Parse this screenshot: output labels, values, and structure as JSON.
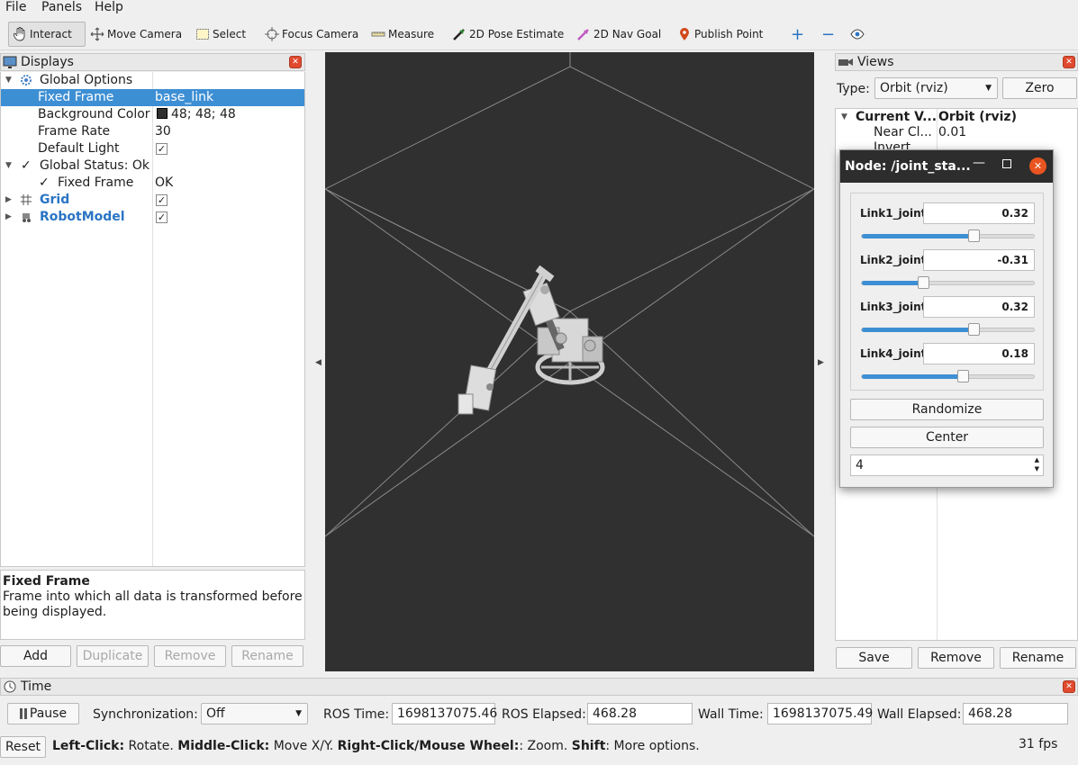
{
  "menu": {
    "file": "File",
    "panels": "Panels",
    "help": "Help"
  },
  "toolbar": {
    "interact": "Interact",
    "move_camera": "Move Camera",
    "select": "Select",
    "focus_camera": "Focus Camera",
    "measure": "Measure",
    "pose_estimate": "2D Pose Estimate",
    "nav_goal": "2D Nav Goal",
    "publish_point": "Publish Point",
    "plus": "+",
    "minus": "−"
  },
  "displays": {
    "title": "Displays",
    "rows": [
      {
        "key": "Global Options",
        "value": ""
      },
      {
        "key": "Fixed Frame",
        "value": "base_link"
      },
      {
        "key": "Background Color",
        "value": "48; 48; 48"
      },
      {
        "key": "Frame Rate",
        "value": "30"
      },
      {
        "key": "Default Light",
        "value": "✓"
      },
      {
        "key": "Global Status: Ok",
        "value": ""
      },
      {
        "key": "Fixed Frame",
        "value": "OK"
      },
      {
        "key": "Grid",
        "value": "✓"
      },
      {
        "key": "RobotModel",
        "value": "✓"
      }
    ],
    "desc_title": "Fixed Frame",
    "desc_text": "Frame into which all data is transformed before being displayed.",
    "buttons": {
      "add": "Add",
      "duplicate": "Duplicate",
      "remove": "Remove",
      "rename": "Rename"
    }
  },
  "views": {
    "title": "Views",
    "type_label": "Type:",
    "type_value": "Orbit (rviz)",
    "zero": "Zero",
    "current_key": "Current V...",
    "current_value": "Orbit (rviz)",
    "near_key": "Near Cl...",
    "near_value": "0.01",
    "invert_key": "Invert",
    "buttons": {
      "save": "Save",
      "remove": "Remove",
      "rename": "Rename"
    }
  },
  "dialog": {
    "title": "Node: /joint_sta...",
    "joints": [
      {
        "name": "Link1_joint",
        "value": "0.32",
        "level": 0.64
      },
      {
        "name": "Link2_joint",
        "value": "-0.31",
        "level": 0.35
      },
      {
        "name": "Link3_joint",
        "value": "0.32",
        "level": 0.64
      },
      {
        "name": "Link4_joint",
        "value": "0.18",
        "level": 0.58
      }
    ],
    "randomize": "Randomize",
    "center": "Center",
    "spin_value": "4"
  },
  "time": {
    "title": "Time",
    "pause": "Pause",
    "sync_label": "Synchronization:",
    "sync_value": "Off",
    "ros_time_label": "ROS Time:",
    "ros_time": "1698137075.46",
    "ros_elapsed_label": "ROS Elapsed:",
    "ros_elapsed": "468.28",
    "wall_time_label": "Wall Time:",
    "wall_time": "1698137075.49",
    "wall_elapsed_label": "Wall Elapsed:",
    "wall_elapsed": "468.28"
  },
  "status": {
    "reset": "Reset",
    "left_click": "Left-Click:",
    "left_click_desc": " Rotate. ",
    "middle_click": "Middle-Click:",
    "middle_click_desc": " Move X/Y. ",
    "right_click": "Right-Click/Mouse Wheel:",
    "right_click_desc": ": Zoom. ",
    "shift": "Shift",
    "shift_desc": ": More options.",
    "fps": "31 fps"
  },
  "colors": {
    "selection": "#3d8fd4",
    "viewport_bg": "#303030",
    "close": "#e04a2f",
    "accent_blue": "#2a74c4"
  }
}
